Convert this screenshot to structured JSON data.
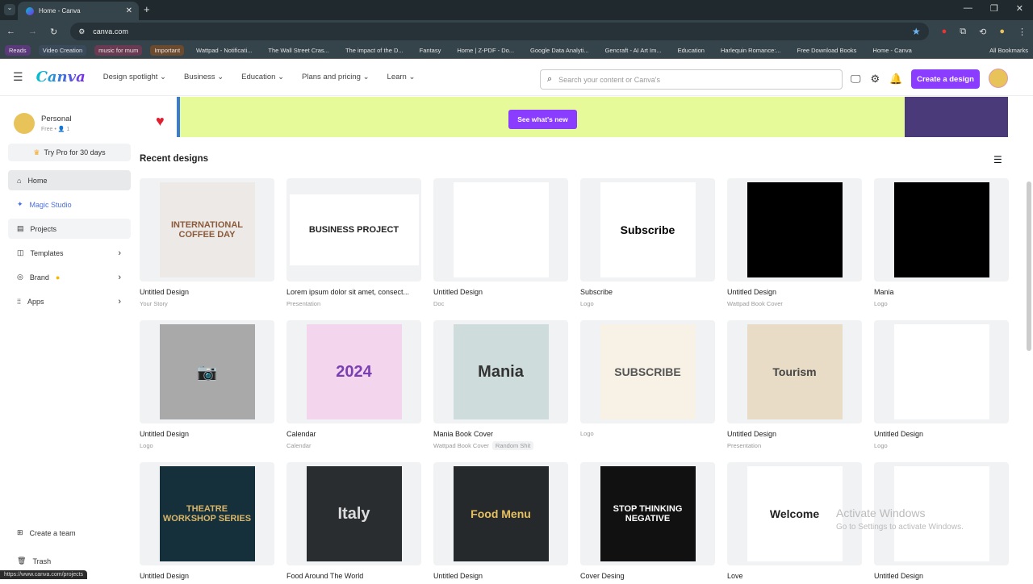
{
  "browser": {
    "tab_title": "Home - Canva",
    "url": "canva.com",
    "bookmarks": [
      {
        "label": "Reads",
        "color": "#5a3a78"
      },
      {
        "label": "Video Creation",
        "color": "#3b4a5a"
      },
      {
        "label": "music for mum",
        "color": "#6a3a52"
      },
      {
        "label": "Important",
        "color": "#6b4a2e"
      },
      {
        "label": "Wattpad - Notificati..."
      },
      {
        "label": "The Wall Street Cras..."
      },
      {
        "label": "The impact of the D..."
      },
      {
        "label": "Fantasy"
      },
      {
        "label": "Home | Z-PDF - Do..."
      },
      {
        "label": "Google Data Analyti..."
      },
      {
        "label": "Gencraft - AI Art Im..."
      },
      {
        "label": "Education"
      },
      {
        "label": "Harlequin Romance:..."
      },
      {
        "label": "Free Download Books"
      },
      {
        "label": "Home - Canva"
      }
    ],
    "all_bookmarks": "All Bookmarks",
    "status_url": "https://www.canva.com/projects"
  },
  "nav": {
    "logo": "Canva",
    "menus": [
      "Design spotlight",
      "Business",
      "Education",
      "Plans and pricing",
      "Learn"
    ],
    "search_placeholder": "Search your content or Canva's",
    "create_label": "Create a design",
    "accent": "#8b3dff"
  },
  "sidebar": {
    "name": "Personal",
    "plan": "Free • 👤 1",
    "pro": "Try Pro for 30 days",
    "items": [
      {
        "label": "Home",
        "icon": "home-icon"
      },
      {
        "label": "Magic Studio",
        "icon": "sparkle-icon"
      },
      {
        "label": "Projects",
        "icon": "folder-icon"
      },
      {
        "label": "Templates",
        "icon": "template-icon"
      },
      {
        "label": "Brand",
        "icon": "brand-icon"
      },
      {
        "label": "Apps",
        "icon": "apps-icon"
      }
    ],
    "create_team": "Create a team",
    "trash": "Trash"
  },
  "banner": {
    "button": "See what's new"
  },
  "recent": {
    "heading": "Recent designs",
    "designs": [
      {
        "title": "Untitled Design",
        "sub": "Your Story",
        "thumb": "INTERNATIONAL COFFEE DAY",
        "bg": "#ece9e6",
        "fg": "#8a5a3a"
      },
      {
        "title": "Lorem ipsum dolor sit amet, consect...",
        "sub": "Presentation",
        "thumb": "BUSINESS PROJECT",
        "bg": "#ffffff",
        "fg": "#222"
      },
      {
        "title": "Untitled Design",
        "sub": "Doc",
        "thumb": "",
        "bg": "#ffffff",
        "fg": "#000"
      },
      {
        "title": "Subscribe",
        "sub": "Logo",
        "thumb": "Subscribe",
        "bg": "#ffffff",
        "fg": "#000"
      },
      {
        "title": "Untitled Design",
        "sub": "Wattpad Book Cover",
        "thumb": "",
        "bg": "#000000",
        "fg": "#fff"
      },
      {
        "title": "Mania",
        "sub": "Logo",
        "thumb": "",
        "bg": "#000000",
        "fg": "#fff"
      },
      {
        "title": "Untitled Design",
        "sub": "Logo",
        "thumb": "📷",
        "bg": "#a9a9a9",
        "fg": "#333"
      },
      {
        "title": "Calendar",
        "sub": "Calendar",
        "thumb": "2024",
        "bg": "#f3d6ee",
        "fg": "#7a3fb0"
      },
      {
        "title": "Mania Book Cover",
        "sub": "Wattpad Book Cover",
        "tag": "Random Shit",
        "thumb": "Mania",
        "bg": "#cfdcdc",
        "fg": "#333"
      },
      {
        "title": "",
        "sub": "Logo",
        "thumb": "SUBSCRIBE",
        "bg": "#f7f1e6",
        "fg": "#555"
      },
      {
        "title": "Untitled Design",
        "sub": "Presentation",
        "thumb": "Tourism",
        "bg": "#e8dcc6",
        "fg": "#444"
      },
      {
        "title": "Untitled Design",
        "sub": "Logo",
        "thumb": "",
        "bg": "#ffffff",
        "fg": "#000"
      },
      {
        "title": "Untitled Design",
        "sub": "",
        "thumb": "THEATRE WORKSHOP SERIES",
        "bg": "#15303a",
        "fg": "#d9b56a"
      },
      {
        "title": "Food Around The World",
        "sub": "",
        "thumb": "Italy",
        "bg": "#2a2d30",
        "fg": "#ddd"
      },
      {
        "title": "Untitled Design",
        "sub": "",
        "thumb": "Food Menu",
        "bg": "#26292c",
        "fg": "#e6c060"
      },
      {
        "title": "Cover Desing",
        "sub": "",
        "thumb": "STOP THINKING NEGATIVE",
        "bg": "#111111",
        "fg": "#fff"
      },
      {
        "title": "Love",
        "sub": "",
        "thumb": "Welcome",
        "bg": "#ffffff",
        "fg": "#222"
      },
      {
        "title": "Untitled Design",
        "sub": "",
        "thumb": "",
        "bg": "#ffffff",
        "fg": "#000"
      }
    ]
  },
  "watermark": {
    "title": "Activate Windows",
    "sub": "Go to Settings to activate Windows."
  }
}
